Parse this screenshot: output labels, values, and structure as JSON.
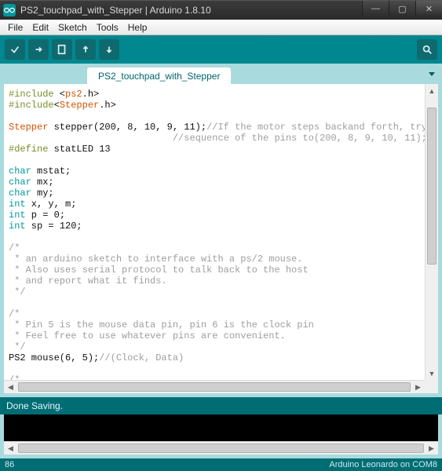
{
  "window": {
    "title": "PS2_touchpad_with_Stepper | Arduino 1.8.10"
  },
  "menu": {
    "file": "File",
    "edit": "Edit",
    "sketch": "Sketch",
    "tools": "Tools",
    "help": "Help"
  },
  "tabs": {
    "main": "PS2_touchpad_with_Stepper"
  },
  "code": {
    "l1a": "#include",
    "l1b": " <",
    "l1c": "ps2",
    "l1d": ".h>",
    "l2a": "#include",
    "l2b": "<",
    "l2c": "Stepper",
    "l2d": ".h>",
    "l4a": "Stepper",
    "l4b": " stepper(200, 8, 10, 9, 11);",
    "l4c": "//If the motor steps backand forth, try replacing the",
    "l5": "                             //sequence of the pins to(200, 8, 9, 10, 11);",
    "l6a": "#define",
    "l6b": " statLED 13",
    "l8a": "char",
    "l8b": " mstat;",
    "l9a": "char",
    "l9b": " mx;",
    "l10a": "char",
    "l10b": " my;",
    "l11a": "int",
    "l11b": " x, y, m;",
    "l12a": "int",
    "l12b": " p = 0;",
    "l13a": "int",
    "l13b": " sp = 120;",
    "l15": "/*",
    "l16": " * an arduino sketch to interface with a ps/2 mouse.",
    "l17": " * Also uses serial protocol to talk back to the host",
    "l18": " * and report what it finds.",
    "l19": " */",
    "l21": "/*",
    "l22": " * Pin 5 is the mouse data pin, pin 6 is the clock pin",
    "l23": " * Feel free to use whatever pins are convenient.",
    "l24": " */",
    "l25a": "PS2 mouse(6, 5);",
    "l25b": "//(Clock, Data)",
    "l27": "/*"
  },
  "message": "Done Saving.",
  "status": {
    "line": "86",
    "board": "Arduino Leonardo on COM8"
  }
}
